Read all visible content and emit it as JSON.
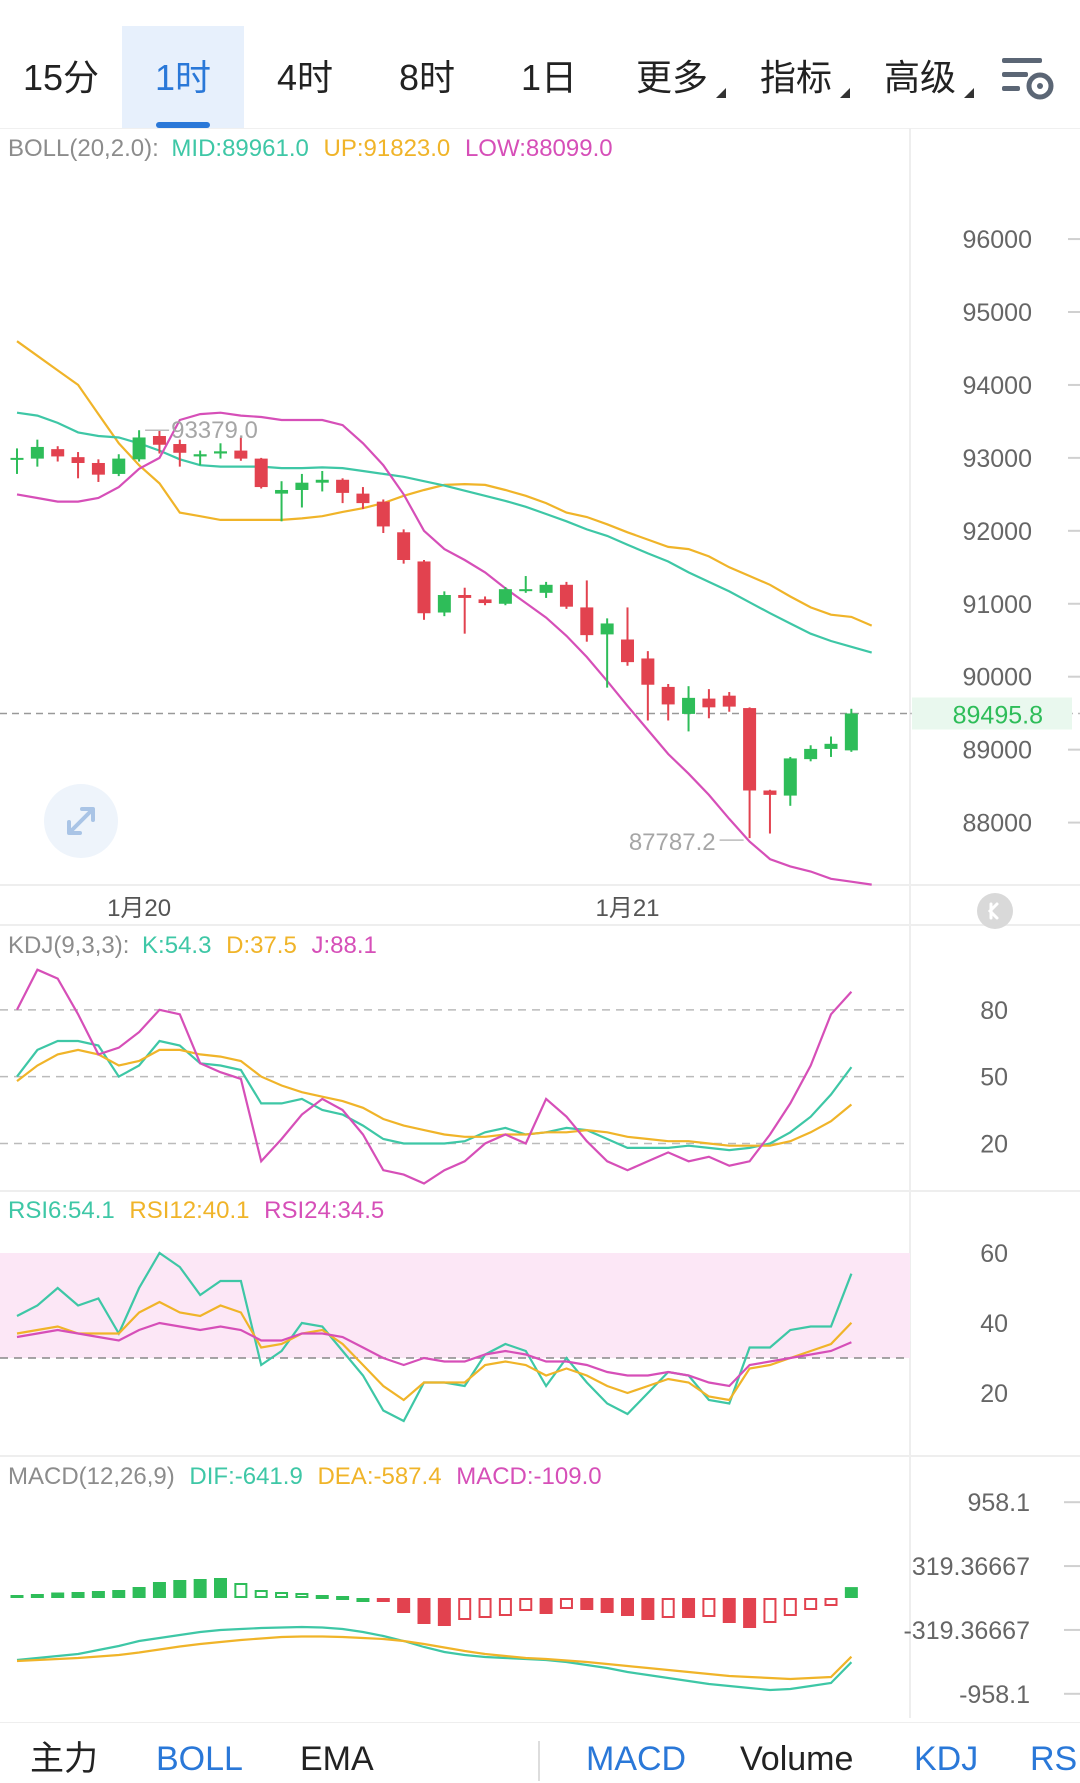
{
  "tabs": [
    {
      "label": "15分",
      "active": false,
      "more": false
    },
    {
      "label": "1时",
      "active": true,
      "more": false
    },
    {
      "label": "4时",
      "active": false,
      "more": false
    },
    {
      "label": "8时",
      "active": false,
      "more": false
    },
    {
      "label": "1日",
      "active": false,
      "more": false
    },
    {
      "label": "更多",
      "active": false,
      "more": true
    },
    {
      "label": "指标",
      "active": false,
      "more": true
    },
    {
      "label": "高级",
      "active": false,
      "more": true
    }
  ],
  "icons": {
    "settings": "chart-settings-icon",
    "expand": "expand-arrows-icon",
    "collapse": "double-chevron-left-icon"
  },
  "colors": {
    "up": "#2ebd59",
    "down": "#e2424f",
    "mid": "#3ec7a6",
    "upper": "#f0b429",
    "lower": "#d64fb8",
    "accent": "#2a78d8"
  },
  "main_legend": {
    "name": "BOLL(20,2.0):",
    "mid": "MID:89961.0",
    "up": "UP:91823.0",
    "low": "LOW:88099.0"
  },
  "kdj_legend": {
    "name": "KDJ(9,3,3):",
    "k": "K:54.3",
    "d": "D:37.5",
    "j": "J:88.1"
  },
  "rsi_legend": {
    "r6": "RSI6:54.1",
    "r12": "RSI12:40.1",
    "r24": "RSI24:34.5"
  },
  "macd_legend": {
    "name": "MACD(12,26,9)",
    "dif": "DIF:-641.9",
    "dea": "DEA:-587.4",
    "macd": "MACD:-109.0"
  },
  "bottom_tabs": [
    {
      "label": "主力",
      "active": false
    },
    {
      "label": "BOLL",
      "active": true
    },
    {
      "label": "EMA",
      "active": false
    },
    {
      "label": "MACD",
      "active": true
    },
    {
      "label": "Volume",
      "active": false
    },
    {
      "label": "KDJ",
      "active": true
    },
    {
      "label": "RSI",
      "active": true
    }
  ],
  "chart_data": [
    {
      "type": "candlestick",
      "panel": "main",
      "yticks": [
        96000,
        95000,
        94000,
        93000,
        92000,
        91000,
        90000,
        89000,
        88000
      ],
      "ylim": [
        87350,
        96700
      ],
      "xticks": [
        {
          "label": "1月20",
          "index": 6
        },
        {
          "label": "1月21",
          "index": 30
        }
      ],
      "current_price": 89495.8,
      "annotations": [
        {
          "text": "93379.0",
          "index": 6,
          "value": 93379.0
        },
        {
          "text": "87787.2",
          "index": 36,
          "value": 87787.2
        }
      ],
      "candles": [
        {
          "o": 92980,
          "h": 93130,
          "l": 92780,
          "c": 93000
        },
        {
          "o": 92990,
          "h": 93250,
          "l": 92880,
          "c": 93150
        },
        {
          "o": 93120,
          "h": 93160,
          "l": 92950,
          "c": 93020
        },
        {
          "o": 93010,
          "h": 93080,
          "l": 92720,
          "c": 92930
        },
        {
          "o": 92930,
          "h": 92980,
          "l": 92670,
          "c": 92770
        },
        {
          "o": 92780,
          "h": 93050,
          "l": 92750,
          "c": 92990
        },
        {
          "o": 92980,
          "h": 93379,
          "l": 92950,
          "c": 93280
        },
        {
          "o": 93300,
          "h": 93370,
          "l": 93060,
          "c": 93180
        },
        {
          "o": 93190,
          "h": 93250,
          "l": 92880,
          "c": 93070
        },
        {
          "o": 93020,
          "h": 93100,
          "l": 92900,
          "c": 93050
        },
        {
          "o": 93060,
          "h": 93200,
          "l": 92990,
          "c": 93090
        },
        {
          "o": 93100,
          "h": 93280,
          "l": 92960,
          "c": 92990
        },
        {
          "o": 92990,
          "h": 93000,
          "l": 92580,
          "c": 92600
        },
        {
          "o": 92510,
          "h": 92680,
          "l": 92130,
          "c": 92560
        },
        {
          "o": 92560,
          "h": 92780,
          "l": 92320,
          "c": 92660
        },
        {
          "o": 92660,
          "h": 92820,
          "l": 92540,
          "c": 92700
        },
        {
          "o": 92700,
          "h": 92720,
          "l": 92380,
          "c": 92520
        },
        {
          "o": 92510,
          "h": 92600,
          "l": 92300,
          "c": 92380
        },
        {
          "o": 92400,
          "h": 92430,
          "l": 91970,
          "c": 92060
        },
        {
          "o": 91980,
          "h": 92020,
          "l": 91550,
          "c": 91600
        },
        {
          "o": 91580,
          "h": 91600,
          "l": 90780,
          "c": 90870
        },
        {
          "o": 90880,
          "h": 91170,
          "l": 90830,
          "c": 91120
        },
        {
          "o": 91120,
          "h": 91220,
          "l": 90590,
          "c": 91080
        },
        {
          "o": 91060,
          "h": 91100,
          "l": 90980,
          "c": 91010
        },
        {
          "o": 91000,
          "h": 91230,
          "l": 90980,
          "c": 91200
        },
        {
          "o": 91180,
          "h": 91380,
          "l": 91150,
          "c": 91200
        },
        {
          "o": 91150,
          "h": 91300,
          "l": 91080,
          "c": 91260
        },
        {
          "o": 91260,
          "h": 91300,
          "l": 90930,
          "c": 90960
        },
        {
          "o": 90950,
          "h": 91320,
          "l": 90480,
          "c": 90570
        },
        {
          "o": 90580,
          "h": 90800,
          "l": 89850,
          "c": 90730
        },
        {
          "o": 90510,
          "h": 90950,
          "l": 90150,
          "c": 90200
        },
        {
          "o": 90250,
          "h": 90350,
          "l": 89400,
          "c": 89890
        },
        {
          "o": 89860,
          "h": 89900,
          "l": 89400,
          "c": 89620
        },
        {
          "o": 89490,
          "h": 89870,
          "l": 89250,
          "c": 89710
        },
        {
          "o": 89700,
          "h": 89830,
          "l": 89430,
          "c": 89580
        },
        {
          "o": 89740,
          "h": 89790,
          "l": 89520,
          "c": 89590
        },
        {
          "o": 89570,
          "h": 89580,
          "l": 87787,
          "c": 88440
        },
        {
          "o": 88440,
          "h": 88450,
          "l": 87850,
          "c": 88380
        },
        {
          "o": 88370,
          "h": 88900,
          "l": 88230,
          "c": 88880
        },
        {
          "o": 88870,
          "h": 89060,
          "l": 88840,
          "c": 89010
        },
        {
          "o": 89010,
          "h": 89180,
          "l": 88900,
          "c": 89080
        },
        {
          "o": 88990,
          "h": 89560,
          "l": 88970,
          "c": 89495.8
        }
      ],
      "series": [
        {
          "name": "UP",
          "values": [
            94600,
            94400,
            94200,
            94000,
            93600,
            93200,
            92900,
            92650,
            92250,
            92200,
            92150,
            92150,
            92150,
            92150,
            92170,
            92200,
            92260,
            92310,
            92380,
            92480,
            92560,
            92630,
            92640,
            92630,
            92560,
            92480,
            92380,
            92250,
            92190,
            92090,
            91980,
            91880,
            91780,
            91750,
            91650,
            91500,
            91380,
            91260,
            91100,
            90950,
            90850,
            90820,
            90700
          ]
        },
        {
          "name": "MID",
          "values": [
            93620,
            93580,
            93480,
            93350,
            93300,
            93280,
            93200,
            93100,
            92980,
            92900,
            92880,
            92880,
            92880,
            92860,
            92860,
            92870,
            92860,
            92820,
            92780,
            92740,
            92680,
            92620,
            92550,
            92480,
            92410,
            92330,
            92230,
            92130,
            92020,
            91930,
            91810,
            91690,
            91580,
            91430,
            91300,
            91170,
            91020,
            90870,
            90730,
            90590,
            90490,
            90410,
            90330
          ]
        },
        {
          "name": "LOW",
          "values": [
            92500,
            92450,
            92400,
            92400,
            92450,
            92600,
            92850,
            93000,
            93520,
            93600,
            93620,
            93580,
            93560,
            93520,
            93520,
            93520,
            93450,
            93200,
            92900,
            92500,
            92000,
            91750,
            91600,
            91430,
            91210,
            91010,
            90810,
            90560,
            90270,
            89940,
            89600,
            89270,
            88940,
            88670,
            88380,
            88050,
            87740,
            87500,
            87400,
            87330,
            87230,
            87190,
            87150
          ]
        }
      ]
    },
    {
      "type": "line",
      "panel": "KDJ",
      "yticks": [
        80,
        50,
        20
      ],
      "ylim": [
        0,
        110
      ],
      "series": [
        {
          "name": "K",
          "values": [
            50,
            62,
            66,
            66,
            64,
            50,
            55,
            66,
            64,
            56,
            55,
            53,
            38,
            38,
            40,
            35,
            33,
            28,
            22,
            20,
            20,
            20,
            21,
            25,
            27,
            24,
            25,
            27,
            26,
            22,
            18,
            18,
            18,
            19,
            18,
            17,
            18,
            20,
            25,
            32,
            42,
            54.3
          ]
        },
        {
          "name": "D",
          "values": [
            48,
            55,
            60,
            62,
            60,
            55,
            57,
            62,
            62,
            60,
            59,
            57,
            50,
            46,
            43,
            41,
            39,
            36,
            31,
            28,
            26,
            24,
            23,
            23,
            24,
            24,
            25,
            25,
            26,
            25,
            23,
            22,
            21,
            21,
            20,
            19,
            19,
            19,
            21,
            25,
            30,
            37.5
          ]
        },
        {
          "name": "J",
          "values": [
            80,
            98,
            94,
            78,
            60,
            63,
            70,
            80,
            78,
            56,
            52,
            49,
            12,
            22,
            33,
            40,
            35,
            24,
            8,
            6,
            2,
            8,
            12,
            20,
            24,
            20,
            40,
            32,
            21,
            12,
            8,
            12,
            16,
            12,
            14,
            10,
            12,
            24,
            38,
            55,
            78,
            88.1
          ]
        }
      ]
    },
    {
      "type": "line",
      "panel": "RSI",
      "yticks": [
        60,
        40,
        20
      ],
      "ylim": [
        0,
        70
      ],
      "band": [
        30,
        60
      ],
      "series": [
        {
          "name": "RSI6",
          "values": [
            42,
            45,
            50,
            45,
            47,
            37,
            50,
            60,
            56,
            48,
            52,
            52,
            28,
            32,
            40,
            39,
            32,
            25,
            15,
            12,
            23,
            23,
            22,
            31,
            34,
            32,
            22,
            30,
            23,
            17,
            14,
            20,
            26,
            25,
            18,
            17,
            33,
            33,
            38,
            39,
            39,
            54.1
          ]
        },
        {
          "name": "RSI12",
          "values": [
            37,
            38,
            39,
            37,
            37,
            37,
            43,
            46,
            43,
            42,
            45,
            43,
            33,
            34,
            37,
            38,
            34,
            28,
            22,
            18,
            23,
            23,
            23,
            28,
            29,
            28,
            25,
            27,
            25,
            22,
            20,
            22,
            24,
            23,
            19,
            18,
            27,
            28,
            30,
            32,
            34,
            40.1
          ]
        },
        {
          "name": "RSI24",
          "values": [
            36,
            37,
            38,
            37,
            36,
            35,
            38,
            40,
            39,
            38,
            39,
            38,
            35,
            35,
            37,
            37,
            36,
            33,
            30,
            28,
            30,
            29,
            29,
            31,
            32,
            31,
            29,
            29,
            28,
            26,
            25,
            25,
            26,
            25,
            23,
            22,
            28,
            29,
            30,
            31,
            32,
            34.5
          ]
        }
      ]
    },
    {
      "type": "bar+line",
      "panel": "MACD",
      "yticks": [
        "958.1",
        "319.36667",
        "-319.36667",
        "-958.1"
      ],
      "ylim": [
        -1000,
        1000
      ],
      "series": [
        {
          "name": "MACD",
          "values": [
            30,
            40,
            55,
            60,
            70,
            80,
            110,
            160,
            180,
            190,
            200,
            150,
            80,
            60,
            50,
            30,
            20,
            0,
            -40,
            -150,
            -260,
            -280,
            -220,
            -200,
            -180,
            -130,
            -160,
            -110,
            -120,
            -150,
            -180,
            -220,
            -200,
            -200,
            -190,
            -250,
            -300,
            -250,
            -180,
            -120,
            -80,
            109
          ]
        },
        {
          "name": "DIF",
          "values": [
            -620,
            -600,
            -580,
            -560,
            -520,
            -480,
            -430,
            -400,
            -370,
            -340,
            -320,
            -310,
            -300,
            -295,
            -290,
            -295,
            -310,
            -340,
            -380,
            -430,
            -490,
            -540,
            -570,
            -590,
            -600,
            -610,
            -620,
            -640,
            -670,
            -700,
            -740,
            -770,
            -800,
            -830,
            -860,
            -880,
            -900,
            -920,
            -910,
            -880,
            -850,
            -641.9
          ]
        },
        {
          "name": "DEA",
          "values": [
            -630,
            -620,
            -610,
            -600,
            -585,
            -570,
            -545,
            -515,
            -485,
            -460,
            -440,
            -420,
            -405,
            -390,
            -385,
            -385,
            -390,
            -400,
            -410,
            -430,
            -460,
            -495,
            -530,
            -560,
            -580,
            -600,
            -610,
            -625,
            -640,
            -660,
            -680,
            -700,
            -720,
            -740,
            -760,
            -780,
            -790,
            -800,
            -810,
            -800,
            -790,
            -587.4
          ]
        }
      ]
    }
  ]
}
